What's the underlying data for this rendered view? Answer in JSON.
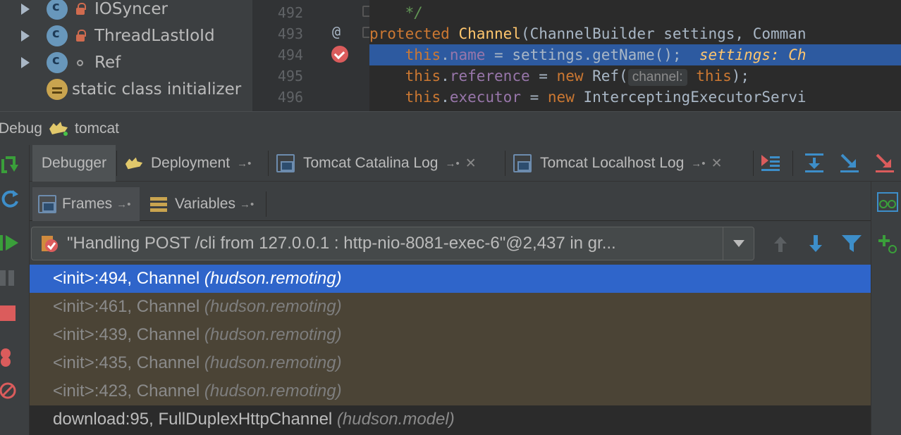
{
  "structure_tree": {
    "items": [
      {
        "label": "IOSyncer"
      },
      {
        "label": "ThreadLastIoId"
      },
      {
        "label": "Ref"
      },
      {
        "label": "static class initializer"
      }
    ]
  },
  "editor": {
    "line_numbers": [
      "492",
      "493",
      "494",
      "495",
      "496"
    ],
    "lines": {
      "l492": "*/",
      "l493_kw": "protected",
      "l493_cls": "Channel",
      "l493_rest": "(ChannelBuilder settings, Comman",
      "l494_this": "this",
      "l494_field": "name",
      "l494_rest": " = settings.getName();",
      "l494_inlay": "settings: Ch",
      "l495_this": "this",
      "l495_field": "reference",
      "l495_eq": " = ",
      "l495_new": "new",
      "l495_ref": " Ref(",
      "l495_hint": "channel:",
      "l495_this2": "this",
      "l495_end": ");",
      "l496_this": "this",
      "l496_field": "executor",
      "l496_eq": " = ",
      "l496_new": "new",
      "l496_rest": " InterceptingExecutorServi"
    },
    "gutter_at": "@"
  },
  "debug_window": {
    "title_prefix": "Debug",
    "config_name": "tomcat"
  },
  "tabs": [
    {
      "label": "Debugger"
    },
    {
      "label": "Deployment"
    },
    {
      "label": "Tomcat Catalina Log"
    },
    {
      "label": "Tomcat Localhost Log"
    }
  ],
  "tab_glyphs": {
    "pin": "→•",
    "close": "✕"
  },
  "subtabs": [
    {
      "label": "Frames"
    },
    {
      "label": "Variables"
    }
  ],
  "thread_selector": {
    "value": "\"Handling POST /cli from 127.0.0.1 : http-nio-8081-exec-6\"@2,437 in gr..."
  },
  "frames": [
    {
      "method": "<init>:494, Channel",
      "package": "(hudson.remoting)",
      "state": "selected"
    },
    {
      "method": "<init>:461, Channel",
      "package": "(hudson.remoting)",
      "state": "library"
    },
    {
      "method": "<init>:439, Channel",
      "package": "(hudson.remoting)",
      "state": "library"
    },
    {
      "method": "<init>:435, Channel",
      "package": "(hudson.remoting)",
      "state": "library"
    },
    {
      "method": "<init>:423, Channel",
      "package": "(hudson.remoting)",
      "state": "library"
    },
    {
      "method": "download:95, FullDuplexHttpChannel",
      "package": "(hudson.model)",
      "state": "normal"
    }
  ],
  "colors": {
    "selection": "#2f65ca",
    "library_frame_bg": "#4b4436",
    "keyword": "#cc7832",
    "field": "#9876aa",
    "panel": "#3c3f41"
  }
}
